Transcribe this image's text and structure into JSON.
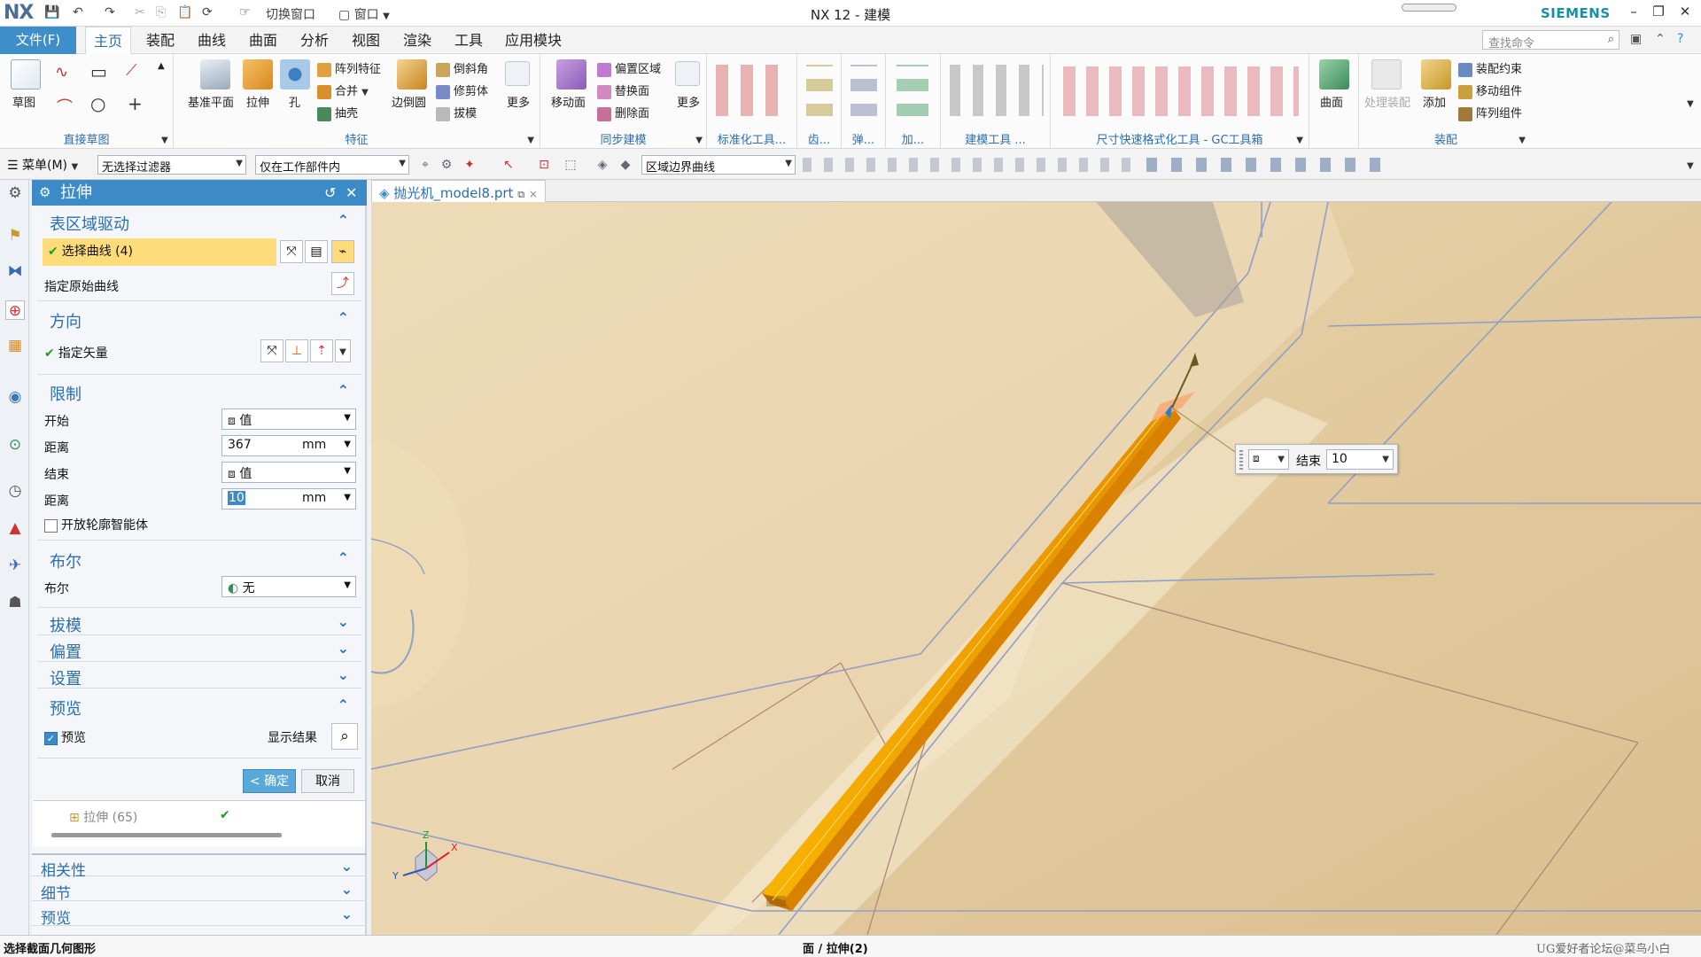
{
  "titlebar": {
    "logo": "NX",
    "switch_window": "切换窗口",
    "window_menu": "窗口",
    "title": "NX 12 - 建模",
    "brand": "SIEMENS"
  },
  "menubar": {
    "file": "文件(F)",
    "tabs": [
      "主页",
      "装配",
      "曲线",
      "曲面",
      "分析",
      "视图",
      "渲染",
      "工具",
      "应用模块"
    ],
    "active_tab": "主页",
    "search_placeholder": "查找命令"
  },
  "ribbon": {
    "groups": {
      "direct_sketch": {
        "label": "直接草图",
        "sketch": "草图"
      },
      "feature": {
        "label": "特征",
        "datum_plane": "基准平面",
        "extrude": "拉伸",
        "hole": "孔",
        "pattern_feature": "阵列特征",
        "unite": "合并",
        "shell": "抽壳",
        "edge_blend": "边倒圆",
        "chamfer": "倒斜角",
        "trim_body": "修剪体",
        "draft": "拔模",
        "more": "更多"
      },
      "sync_modeling": {
        "label": "同步建模",
        "move_face": "移动面",
        "offset_region": "偏置区域",
        "replace_face": "替换面",
        "delete_face": "删除面",
        "more": "更多"
      },
      "standard_tools": {
        "label": "标准化工具..."
      },
      "gear": {
        "label": "齿..."
      },
      "spring": {
        "label": "弹..."
      },
      "add": {
        "label": "加..."
      },
      "modeling_tools": {
        "label": "建模工具 ..."
      },
      "gc_toolbox": {
        "label": "尺寸快速格式化工具 - GC工具箱"
      },
      "surface": {
        "label": "曲面"
      },
      "assembly": {
        "label": "装配",
        "process_assembly": "处理装配",
        "add": "添加",
        "constraint": "装配约束",
        "move_component": "移动组件",
        "pattern_component": "阵列组件"
      }
    }
  },
  "toolbar2": {
    "menu": "菜单(M)",
    "filter": "无选择过滤器",
    "scope": "仅在工作部件内",
    "curve_rule": "区域边界曲线"
  },
  "dialog": {
    "title": "拉伸",
    "sections": {
      "region_drive": {
        "title": "表区域驱动",
        "select_curve": "选择曲线 (4)",
        "original_curve": "指定原始曲线"
      },
      "direction": {
        "title": "方向",
        "vector": "指定矢量"
      },
      "limits": {
        "title": "限制",
        "start_label": "开始",
        "start_value": "值",
        "start_dist_label": "距离",
        "start_dist": "367",
        "end_label": "结束",
        "end_value": "值",
        "end_dist_label": "距离",
        "end_dist": "10",
        "unit": "mm",
        "open_profile": "开放轮廓智能体"
      },
      "boolean": {
        "title": "布尔",
        "label": "布尔",
        "value": "无"
      },
      "draft": {
        "title": "拔模"
      },
      "offset": {
        "title": "偏置"
      },
      "settings": {
        "title": "设置"
      },
      "preview": {
        "title": "预览",
        "checkbox": "预览",
        "show_result": "显示结果"
      }
    },
    "ok": "< 确定 >",
    "cancel": "取消",
    "history_item": "拉伸 (65)"
  },
  "lower_panels": {
    "relevance": "相关性",
    "detail": "细节",
    "preview": "预览"
  },
  "viewport": {
    "tab": "抛光机_model8.prt",
    "handle_end_label": "结束",
    "handle_end_value": "10"
  },
  "statusbar": {
    "prompt": "选择截面几何图形",
    "center": "面 / 拉伸(2)",
    "watermark": "UG爱好者论坛@菜鸟小白"
  },
  "colors": {
    "accent": "#3c8bc6",
    "extrude_body": "#f5a400",
    "background_part": "#e4cca0",
    "highlight": "#ffdc7a"
  }
}
